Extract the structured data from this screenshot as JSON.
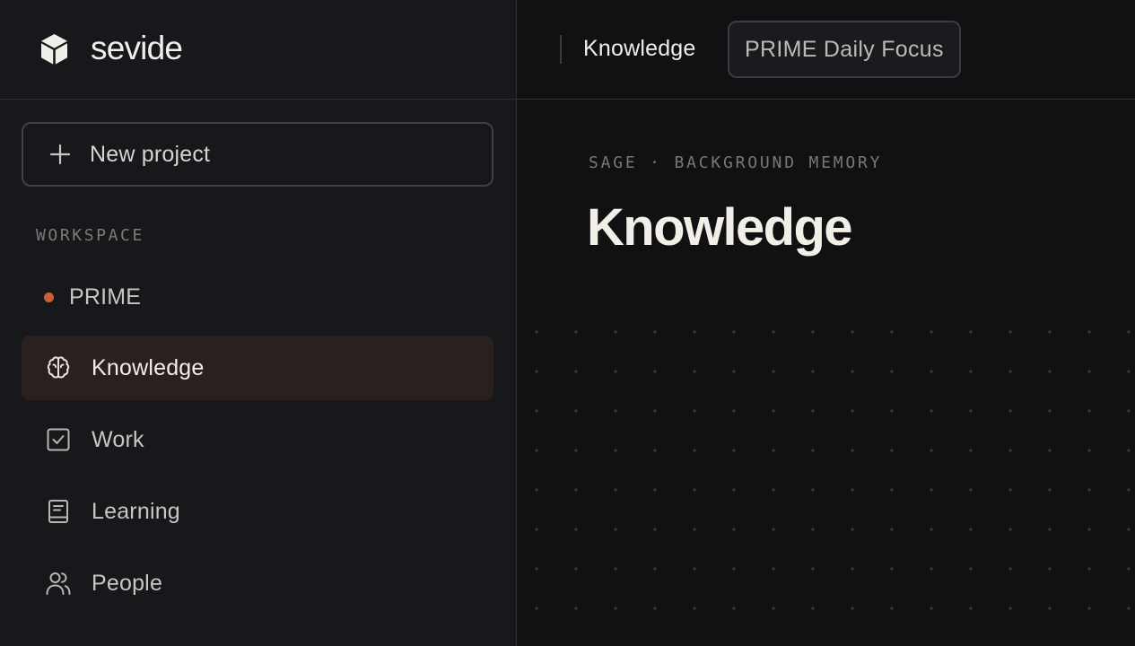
{
  "sidebar": {
    "brand": {
      "name": "sevide",
      "logo_icon": "cube-icon"
    },
    "new_project": {
      "label": "New project",
      "icon": "plus-icon"
    },
    "section_label": "WORKSPACE",
    "items": [
      {
        "label": "PRIME",
        "icon": "status-dot",
        "dot_color": "#c5603a",
        "active": false
      },
      {
        "label": "Knowledge",
        "icon": "brain-icon",
        "active": true
      },
      {
        "label": "Work",
        "icon": "checkbox-icon",
        "active": false
      },
      {
        "label": "Learning",
        "icon": "book-icon",
        "active": false
      },
      {
        "label": "People",
        "icon": "people-icon",
        "active": false
      }
    ]
  },
  "topbar": {
    "breadcrumb": "Knowledge",
    "chip": "PRIME Daily Focus"
  },
  "main": {
    "eyebrow": "SAGE · BACKGROUND MEMORY",
    "title": "Knowledge"
  },
  "colors": {
    "accent_dot": "#c5603a",
    "active_bg": "#2a201d",
    "sidebar_bg": "#17181b",
    "main_bg": "#111113"
  }
}
